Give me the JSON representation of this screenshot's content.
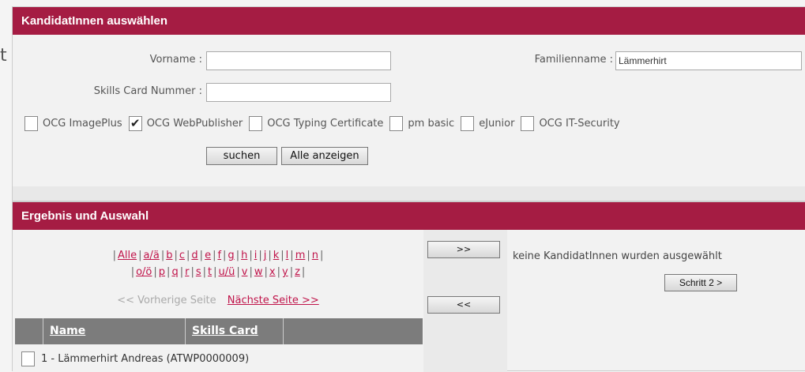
{
  "stray_char": "t",
  "search_panel": {
    "title": "KandidatInnen auswählen",
    "vorname_label": "Vorname :",
    "vorname_value": "",
    "familienname_label": "Familienname :",
    "familienname_value": "Lämmerhirt",
    "skills_label": "Skills Card Nummer :",
    "skills_value": "",
    "checkboxes": [
      {
        "label": "OCG ImagePlus",
        "checked": false
      },
      {
        "label": "OCG WebPublisher",
        "checked": true
      },
      {
        "label": "OCG Typing Certificate",
        "checked": false
      },
      {
        "label": "pm basic",
        "checked": false
      },
      {
        "label": "eJunior",
        "checked": false
      },
      {
        "label": "OCG IT-Security",
        "checked": false
      }
    ],
    "search_button": "suchen",
    "show_all_button": "Alle anzeigen"
  },
  "result_panel": {
    "title": "Ergebnis und Auswahl",
    "alphabet_row1": [
      "Alle",
      "a/ä",
      "b",
      "c",
      "d",
      "e",
      "f",
      "g",
      "h",
      "i",
      "j",
      "k",
      "l",
      "m",
      "n"
    ],
    "alphabet_row2": [
      "o/ö",
      "p",
      "q",
      "r",
      "s",
      "t",
      "u/ü",
      "v",
      "w",
      "x",
      "y",
      "z"
    ],
    "prev_page": "<< Vorherige Seite",
    "next_page": "Nächste Seite >>",
    "add_button": ">>",
    "remove_button": "<<",
    "selection_status": "keine KandidatInnen wurden ausgewählt",
    "next_step_button": "Schritt 2 >",
    "table_headers": {
      "name": "Name",
      "skills_card": "Skills Card"
    },
    "rows": [
      {
        "text": "1 - Lämmerhirt Andreas (ATWP0000009)",
        "checked": false
      }
    ]
  }
}
